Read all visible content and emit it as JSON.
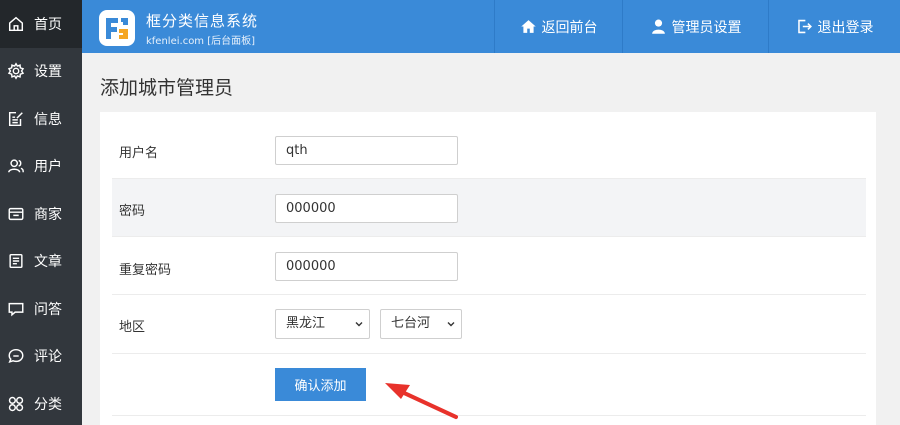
{
  "sidebar": {
    "items": [
      {
        "label": "首页",
        "icon": "home-icon"
      },
      {
        "label": "设置",
        "icon": "gear-icon"
      },
      {
        "label": "信息",
        "icon": "edit-icon"
      },
      {
        "label": "用户",
        "icon": "users-icon"
      },
      {
        "label": "商家",
        "icon": "shop-icon"
      },
      {
        "label": "文章",
        "icon": "document-icon"
      },
      {
        "label": "问答",
        "icon": "chat-icon"
      },
      {
        "label": "评论",
        "icon": "comment-icon"
      },
      {
        "label": "分类",
        "icon": "category-icon"
      }
    ]
  },
  "header": {
    "brand_title": "框分类信息系统",
    "brand_sub": "kfenlei.com [后台面板]",
    "nav_home": "返回前台",
    "nav_admin": "管理员设置",
    "nav_logout": "退出登录"
  },
  "page": {
    "title": "添加城市管理员"
  },
  "form": {
    "username_label": "用户名",
    "username_value": "qth",
    "password_label": "密码",
    "password_value": "000000",
    "repeat_label": "重复密码",
    "repeat_value": "000000",
    "region_label": "地区",
    "province_selected": "黑龙江",
    "city_selected": "七台河",
    "submit_label": "确认添加"
  },
  "colors": {
    "primary": "#3a8ad8",
    "sidebar_bg": "#32373d",
    "annotation_arrow": "#e8322b"
  }
}
